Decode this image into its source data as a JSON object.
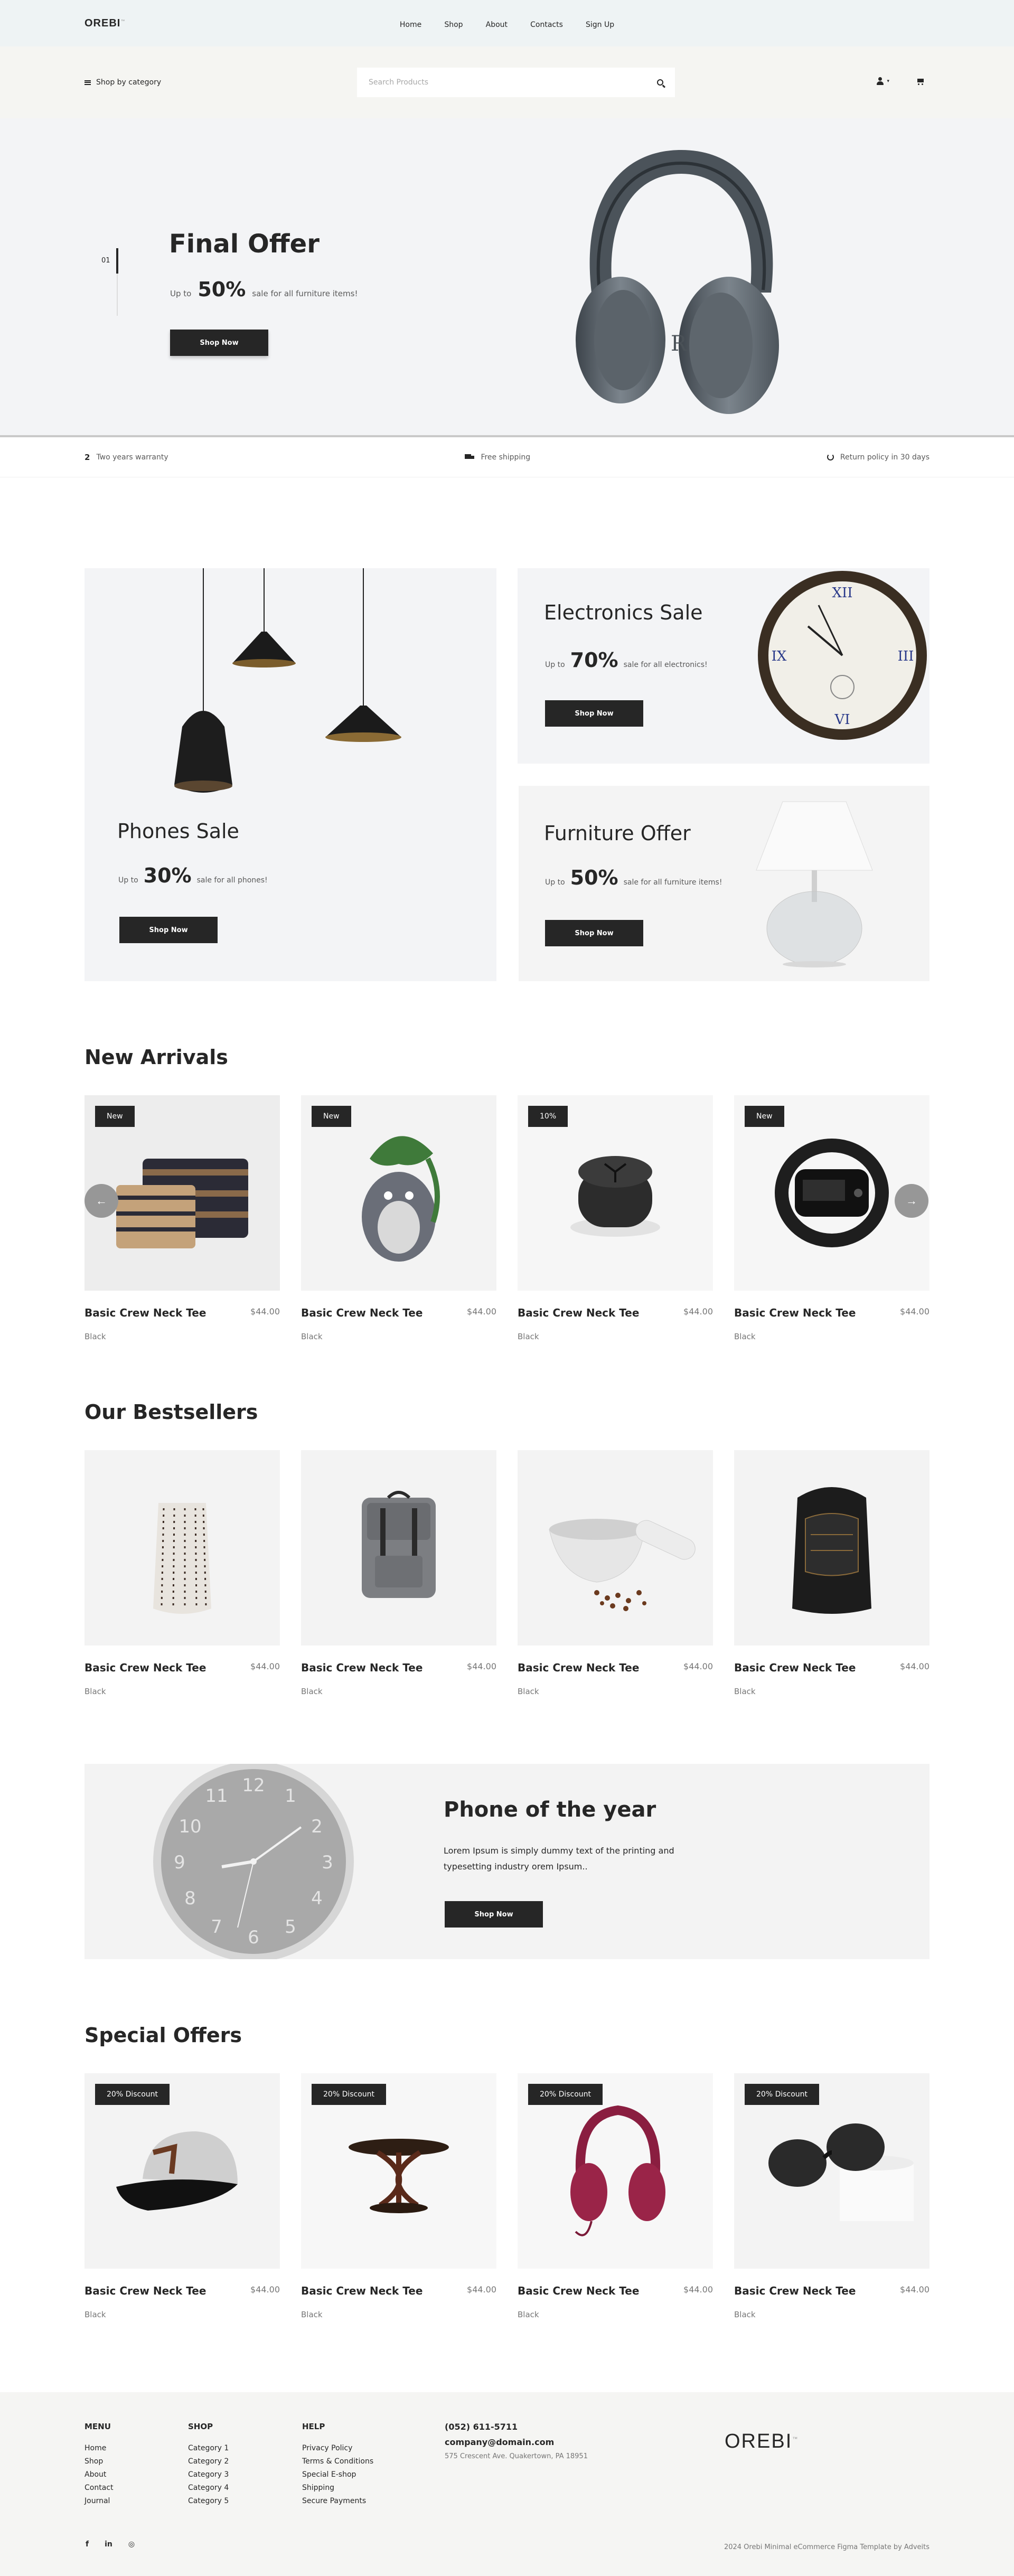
{
  "brand": {
    "logo": "OREBI",
    "logo_mark": "™"
  },
  "nav": {
    "links": [
      "Home",
      "Shop",
      "About",
      "Contacts",
      "Sign Up"
    ]
  },
  "searchbar": {
    "category_label": "Shop by category",
    "placeholder": "Search Products",
    "user_caret": "▾"
  },
  "hero": {
    "slide_number": "01",
    "title": "Final Offer",
    "prefix": "Up to",
    "percent": "50%",
    "suffix": "sale for all furniture items!",
    "button": "Shop Now"
  },
  "features": [
    {
      "icon_text": "2",
      "label": "Two years warranty"
    },
    {
      "label": "Free shipping"
    },
    {
      "label": "Return policy in 30 days"
    }
  ],
  "sales": {
    "phones": {
      "title": "Phones Sale",
      "prefix": "Up to",
      "percent": "30%",
      "suffix": "sale for all phones!",
      "button": "Shop Now"
    },
    "electronics": {
      "title": "Electronics Sale",
      "prefix": "Up to",
      "percent": "70%",
      "suffix": "sale for all electronics!",
      "button": "Shop Now"
    },
    "furniture": {
      "title": "Furniture Offer",
      "prefix": "Up to",
      "percent": "50%",
      "suffix": "sale for all furniture items!",
      "button": "Shop Now"
    }
  },
  "new_arrivals": {
    "title": "New Arrivals",
    "prev_arrow": "←",
    "next_arrow": "→",
    "items": [
      {
        "badge": "New",
        "name": "Basic Crew Neck Tee",
        "price": "$44.00",
        "color": "Black"
      },
      {
        "badge": "New",
        "name": "Basic Crew Neck Tee",
        "price": "$44.00",
        "color": "Black"
      },
      {
        "badge": "10%",
        "name": "Basic Crew Neck Tee",
        "price": "$44.00",
        "color": "Black"
      },
      {
        "badge": "New",
        "name": "Basic Crew Neck Tee",
        "price": "$44.00",
        "color": "Black"
      }
    ]
  },
  "bestsellers": {
    "title": "Our Bestsellers",
    "items": [
      {
        "name": "Basic Crew Neck Tee",
        "price": "$44.00",
        "color": "Black"
      },
      {
        "name": "Basic Crew Neck Tee",
        "price": "$44.00",
        "color": "Black"
      },
      {
        "name": "Basic Crew Neck Tee",
        "price": "$44.00",
        "color": "Black"
      },
      {
        "name": "Basic Crew Neck Tee",
        "price": "$44.00",
        "color": "Black"
      }
    ]
  },
  "phone_of_year": {
    "title": "Phone of the year",
    "text": "Lorem Ipsum is simply dummy text of the printing and typesetting industry orem Ipsum..",
    "button": "Shop Now",
    "clock_numbers": [
      "12",
      "1",
      "2",
      "3",
      "4",
      "5",
      "6",
      "7",
      "8",
      "9",
      "10",
      "11"
    ]
  },
  "special_offers": {
    "title": "Special Offers",
    "items": [
      {
        "badge": "20% Discount",
        "name": "Basic Crew Neck Tee",
        "price": "$44.00",
        "color": "Black"
      },
      {
        "badge": "20% Discount",
        "name": "Basic Crew Neck Tee",
        "price": "$44.00",
        "color": "Black"
      },
      {
        "badge": "20% Discount",
        "name": "Basic Crew Neck Tee",
        "price": "$44.00",
        "color": "Black"
      },
      {
        "badge": "20% Discount",
        "name": "Basic Crew Neck Tee",
        "price": "$44.00",
        "color": "Black"
      }
    ]
  },
  "footer": {
    "menu": {
      "title": "MENU",
      "links": [
        "Home",
        "Shop",
        "About",
        "Contact",
        "Journal"
      ]
    },
    "shop": {
      "title": "SHOP",
      "links": [
        "Category 1",
        "Category 2",
        "Category 3",
        "Category 4",
        "Category 5"
      ]
    },
    "help": {
      "title": "HELP",
      "links": [
        "Privacy Policy",
        "Terms & Conditions",
        "Special E-shop",
        "Shipping",
        "Secure Payments"
      ]
    },
    "contact": {
      "phone": "(052) 611-5711",
      "email": "company@domain.com",
      "address": "575 Crescent Ave. Quakertown, PA 18951"
    },
    "logo": "OREBI",
    "logo_mark": "™",
    "social": [
      "f",
      "in",
      "◎"
    ],
    "copyright": "2024 Orebi Minimal eCommerce Figma Template by Adveits"
  },
  "colors": {
    "dark": "#262626",
    "muted": "#767676",
    "hero_bg": "#f3f4f6",
    "nav_bg": "#eef3f4",
    "footer_bg": "#f5f5f3"
  }
}
